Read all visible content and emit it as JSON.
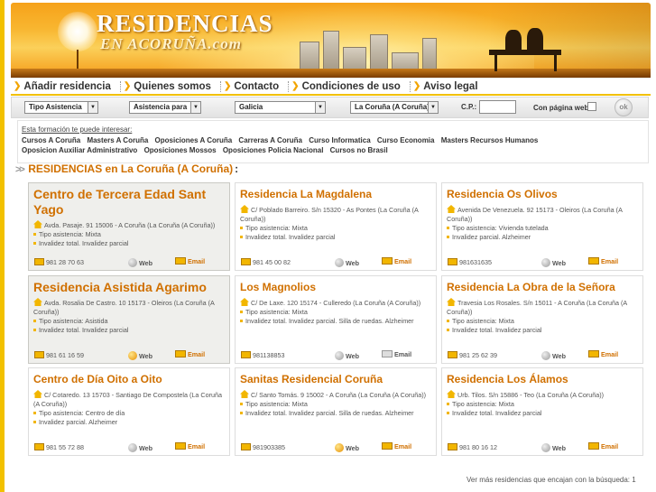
{
  "brand": {
    "top": "RESIDENCIAS",
    "bottom": "EN ACORUÑA.com"
  },
  "menu": [
    {
      "label": "Añadir residencia",
      "name": "menu-anadir-residencia"
    },
    {
      "label": "Quienes somos",
      "name": "menu-quienes-somos"
    },
    {
      "label": "Contacto",
      "name": "menu-contacto"
    },
    {
      "label": "Condiciones de uso",
      "name": "menu-condiciones-de-uso"
    },
    {
      "label": "Aviso legal",
      "name": "menu-aviso-legal"
    }
  ],
  "search": {
    "tipo": "Tipo Asistencia",
    "asistencia": "Asistencia para",
    "region": "Galicia",
    "province": "La Coruña (A Coruña)",
    "cp_label": "C.P.:",
    "web_label": "Con página web",
    "ok": "ok"
  },
  "formacion": {
    "title": "Esta formación te puede interesar:",
    "links": [
      "Cursos A Coruña",
      "Masters A Coruña",
      "Oposiciones A Coruña",
      "Carreras A Coruña",
      "Curso Informatica",
      "Curso Economia",
      "Masters Recursos Humanos",
      "Oposicion Auxiliar Administrativo",
      "Oposiciones Mossos",
      "Oposiciones Policia Nacional",
      "Cursos no Brasil"
    ]
  },
  "results_heading": "RESIDENCIAS en La Coruña (A Coruña)",
  "labels": {
    "web": "Web",
    "email": "Email"
  },
  "cards": [
    {
      "title": "Centro de Tercera Edad Sant Yago",
      "address": "Avda. Pasaje. 91 15006 - A Coruña (La Coruña (A Coruña))",
      "lines": [
        "Tipo asistencia: Mixta",
        "Invalidez total. Invalidez parcial"
      ],
      "phone": "981 28 70 63",
      "web": false,
      "email": true,
      "gray": true,
      "big": true
    },
    {
      "title": "Residencia La Magdalena",
      "address": "C/ Poblado Barreiro. S/n 15320 - As Pontes (La Coruña (A Coruña))",
      "lines": [
        "Tipo asistencia: Mixta",
        "Invalidez total. Invalidez parcial"
      ],
      "phone": "981 45 00 82",
      "web": false,
      "email": true,
      "gray": false,
      "big": false
    },
    {
      "title": "Residencia Os Olivos",
      "address": "Avenida De Venezuela. 92 15173 - Oleiros (La Coruña (A Coruña))",
      "lines": [
        "Tipo asistencia: Vivienda tutelada",
        "Invalidez parcial. Alzheimer"
      ],
      "phone": "981631635",
      "web": false,
      "email": true,
      "gray": false,
      "big": false
    },
    {
      "title": "Residencia Asistida Agarimo",
      "address": "Avda. Rosalia De Castro. 10 15173 - Oleiros (La Coruña (A Coruña))",
      "lines": [
        "Tipo asistencia: Asistida",
        "Invalidez total. Invalidez parcial"
      ],
      "phone": "981 61 16 59",
      "web": true,
      "email": true,
      "gray": true,
      "big": true
    },
    {
      "title": "Los Magnolios",
      "address": "C/ De Laxe. 120 15174 - Culleredo (La Coruña (A Coruña))",
      "lines": [
        "Tipo asistencia: Mixta",
        "Invalidez total. Invalidez parcial. Silla de ruedas. Alzheimer"
      ],
      "phone": "981138853",
      "web": false,
      "email": false,
      "gray": false,
      "big": false
    },
    {
      "title": "Residencia La Obra de la Señora",
      "address": "Travesia Los Rosales. S/n 15011 - A Coruña (La Coruña (A Coruña))",
      "lines": [
        "Tipo asistencia: Mixta",
        "Invalidez total. Invalidez parcial"
      ],
      "phone": "981 25 62 39",
      "web": false,
      "email": true,
      "gray": false,
      "big": false
    },
    {
      "title": "Centro de Día Oito a Oito",
      "address": "C/ Cotaredo. 13 15703 - Santiago De Compostela (La Coruña (A Coruña))",
      "lines": [
        "Tipo asistencia: Centro de día",
        "Invalidez parcial. Alzheimer"
      ],
      "phone": "981 55 72 88",
      "web": false,
      "email": true,
      "gray": false,
      "big": false
    },
    {
      "title": "Sanitas Residencial Coruña",
      "address": "C/ Santo Tomás. 9 15002 - A Coruña (La Coruña (A Coruña))",
      "lines": [
        "Tipo asistencia: Mixta",
        "Invalidez total. Invalidez parcial. Silla de ruedas. Alzheimer"
      ],
      "phone": "981903385",
      "web": true,
      "email": true,
      "gray": false,
      "big": false
    },
    {
      "title": "Residencia Los Álamos",
      "address": "Urb. Tilos. S/n 15886 - Teo (La Coruña (A Coruña))",
      "lines": [
        "Tipo asistencia: Mixta",
        "Invalidez total. Invalidez parcial"
      ],
      "phone": "981 80 16 12",
      "web": false,
      "email": true,
      "gray": false,
      "big": false
    }
  ],
  "more": "Ver más residencias que encajan con la búsqueda:  1"
}
